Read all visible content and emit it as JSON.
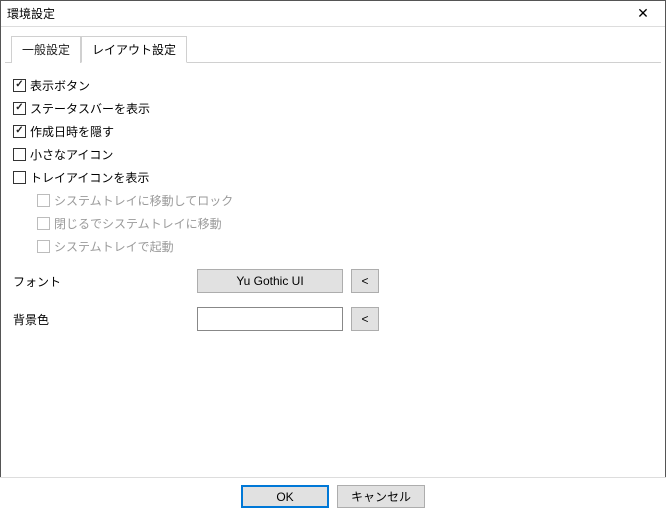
{
  "window": {
    "title": "環境設定"
  },
  "tabs": {
    "general": "一般設定",
    "layout": "レイアウト設定"
  },
  "checks": {
    "show_button": "表示ボタン",
    "show_statusbar": "ステータスバーを表示",
    "hide_created_date": "作成日時を隠す",
    "small_icons": "小さなアイコン",
    "show_tray_icon": "トレイアイコンを表示",
    "tray_move_lock": "システムトレイに移動してロック",
    "tray_move_close": "閉じるでシステムトレイに移動",
    "tray_start": "システムトレイで起動"
  },
  "form": {
    "font_label": "フォント",
    "font_value": "Yu Gothic UI",
    "font_reset": "<",
    "bgcolor_label": "背景色",
    "bgcolor_reset": "<"
  },
  "buttons": {
    "ok": "OK",
    "cancel": "キャンセル"
  }
}
